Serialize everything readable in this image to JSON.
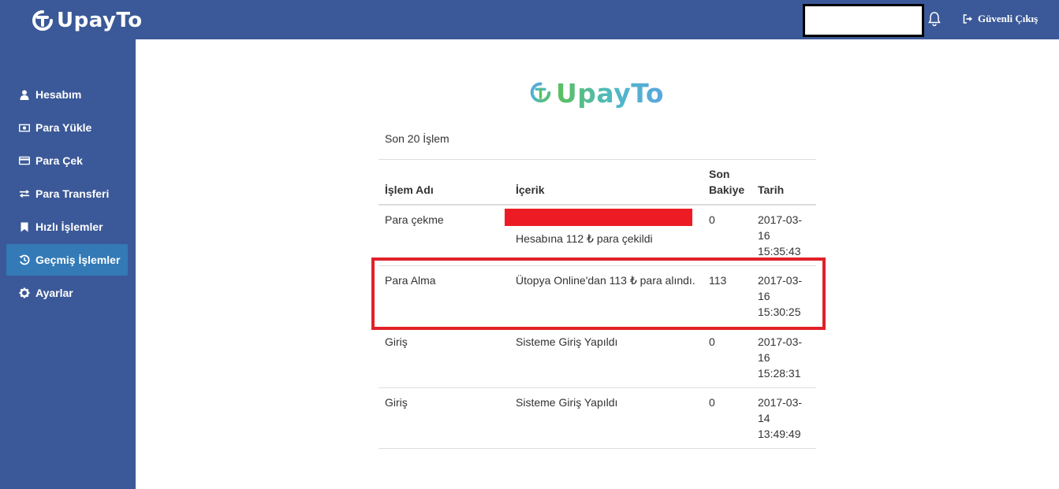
{
  "brand": {
    "name": "UpayTo",
    "primary_color": "#3b5998",
    "accent_active": "#337ab7"
  },
  "header": {
    "bell_icon": "bell-icon",
    "logout_label": "Güvenli Çıkış"
  },
  "sidebar": {
    "items": [
      {
        "label": "Hesabım",
        "icon": "user-icon"
      },
      {
        "label": "Para Yükle",
        "icon": "money-icon"
      },
      {
        "label": "Para Çek",
        "icon": "credit-card-icon"
      },
      {
        "label": "Para Transferi",
        "icon": "exchange-icon"
      },
      {
        "label": "Hızlı İşlemler",
        "icon": "bookmark-icon"
      },
      {
        "label": "Geçmiş İşlemler",
        "icon": "history-icon",
        "active": true
      },
      {
        "label": "Ayarlar",
        "icon": "gear-icon"
      }
    ]
  },
  "main": {
    "section_title": "Son 20 İşlem",
    "table": {
      "headers": [
        "İşlem Adı",
        "İçerik",
        "Son Bakiye",
        "Tarih"
      ],
      "rows": [
        {
          "name": "Para çekme",
          "content": "Hesabına 112 ₺ para çekildi",
          "balance": "0",
          "date": "2017-03-16 15:35:43"
        },
        {
          "name": "Para Alma",
          "content": "Ütopya Online'dan 113 ₺ para alındı.",
          "balance": "113",
          "date": "2017-03-16 15:30:25"
        },
        {
          "name": "Giriş",
          "content": "Sisteme Giriş Yapıldı",
          "balance": "0",
          "date": "2017-03-16 15:28:31"
        },
        {
          "name": "Giriş",
          "content": "Sisteme Giriş Yapıldı",
          "balance": "0",
          "date": "2017-03-14 13:49:49"
        }
      ]
    }
  },
  "annotation": {
    "highlight_color": "#e0212a",
    "redaction_color": "#ed1c24"
  }
}
